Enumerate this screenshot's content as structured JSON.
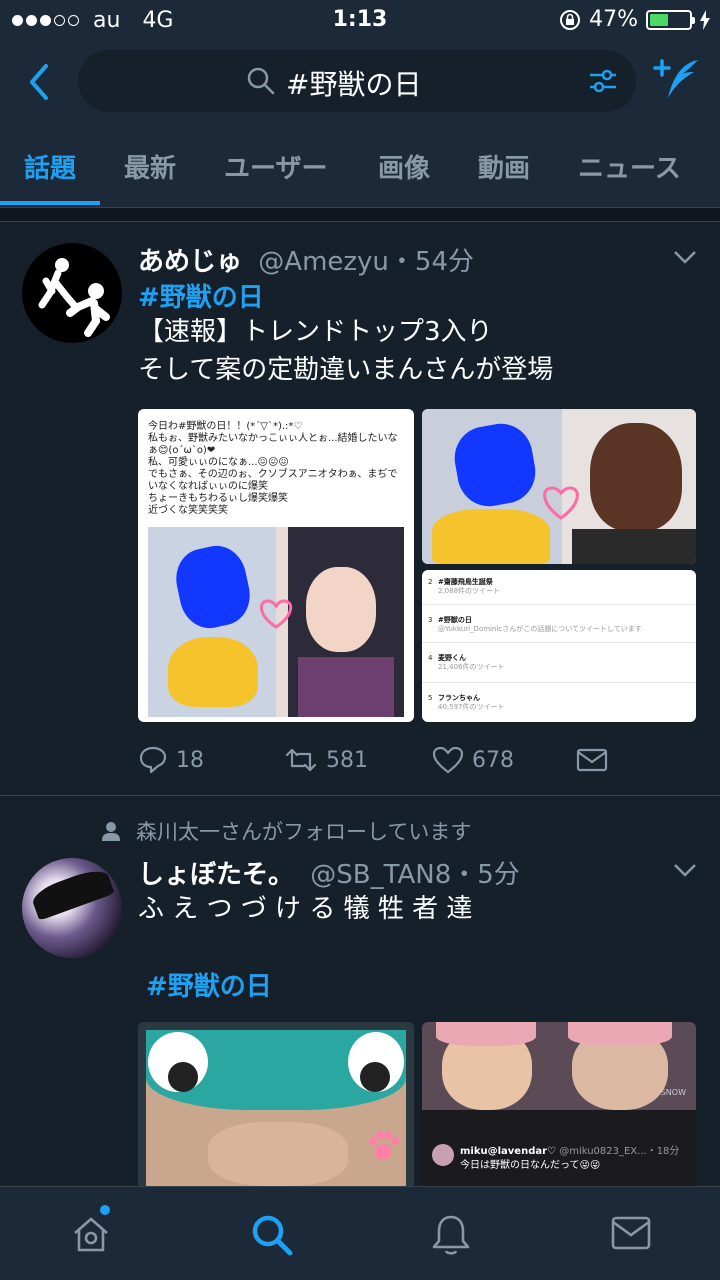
{
  "status_bar": {
    "carrier": "au",
    "network": "4G",
    "time": "1:13",
    "battery": "47%",
    "battery_level": 0.47
  },
  "search": {
    "query": "#野獣の日"
  },
  "tabs": [
    "話題",
    "最新",
    "ユーザー",
    "画像",
    "動画",
    "ニュース"
  ],
  "tweets": [
    {
      "name": "あめじゅ",
      "handle": "@Amezyu・54分",
      "hashtag": "#野獣の日",
      "lines": [
        "【速報】トレンドトップ3入り",
        "そして案の定勘違いまんさんが登場"
      ],
      "media": {
        "screenshot_lines": [
          "今日わ#野獣の日！！(*´▽`*).:*♡",
          "私もぉ、野獣みたいなかっこぃぃ人とぉ...結婚したいな",
          "ぁ😊(o´ω`o)❤",
          "私、可愛ぃぃのになぁ...😖😖😖",
          "でもさぁ、その辺のぉ、クソブスアニオタわぁ、まぢで",
          "いなくなればぃぃのに爆笑",
          "ちょーきもちわるぃし爆笑爆笑",
          "近づくな笑笑笑笑"
        ],
        "trend_rows": [
          {
            "rank": "2",
            "title": "#齋藤飛鳥生誕祭",
            "sub": "2,088件のツイート"
          },
          {
            "rank": "3",
            "title": "#野獣の日",
            "sub": "@Yukkuri_Dominicさんがこの話題についてツイートしています"
          },
          {
            "rank": "4",
            "title": "麦野くん",
            "sub": "21,406件のツイート"
          },
          {
            "rank": "5",
            "title": "フランちゃん",
            "sub": "40,597件のツイート"
          }
        ]
      },
      "replies": "18",
      "retweets": "581",
      "likes": "678"
    },
    {
      "context": "森川太一さんがフォローしています",
      "name": "しょぼたそ。",
      "handle": "@SB_TAN8・5分",
      "line": "ふ え つ づ け る 犠 牲 者 達",
      "hashtag": "#野獣の日",
      "media": {
        "embedded_user": "miku@lavendar♡",
        "embedded_handle": "@miku0823_EX...・18分",
        "embedded_text": "今日は野獣の日なんだって😜😜",
        "watermark": "SNOW"
      }
    }
  ],
  "colors": {
    "accent": "#1da1f2",
    "bg": "#15202b",
    "bar": "#1c2938",
    "muted": "#8899a6"
  },
  "bottom_tabs": [
    "home-icon",
    "search-icon",
    "bell-icon",
    "mail-icon"
  ]
}
